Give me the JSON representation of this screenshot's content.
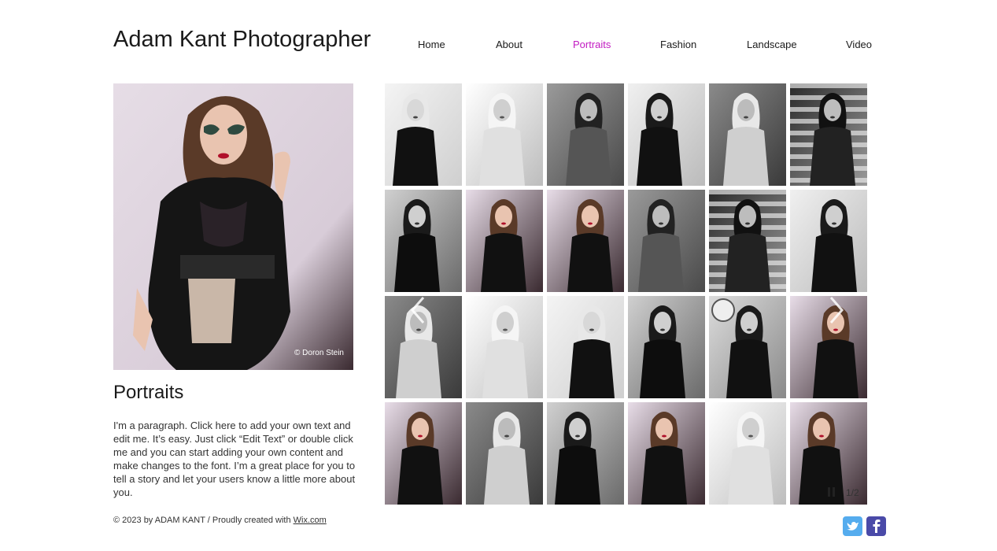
{
  "site": {
    "title": "Adam Kant Photographer"
  },
  "nav": {
    "items": [
      {
        "label": "Home",
        "active": false
      },
      {
        "label": "About",
        "active": false
      },
      {
        "label": "Portraits",
        "active": true
      },
      {
        "label": "Fashion",
        "active": false
      },
      {
        "label": "Landscape",
        "active": false
      },
      {
        "label": "Video",
        "active": false
      }
    ],
    "active_color": "#c21bc2"
  },
  "feature": {
    "credit": "© Doron Stein"
  },
  "section": {
    "title": "Portraits",
    "paragraph": "I'm a paragraph. Click here to add your own text and edit me. It’s easy. Just click “Edit Text” or double click me and you can start adding your own content and make changes to the font. I’m a great place for you to tell a story and let your users know a little more about you."
  },
  "gallery": {
    "counter": "1/2",
    "thumbnails": [
      "wind-hair",
      "white-feathers",
      "arms-crossed",
      "raised-arm-dress",
      "feather-hair",
      "striped-shadow",
      "dark-jacket",
      "red-lips-color",
      "red-lips-color",
      "arms-crossed",
      "striped-shadow",
      "raised-arm-dress",
      "feather-hair",
      "white-feathers",
      "wind-hair",
      "dark-jacket",
      "clock-pose",
      "red-lips-color",
      "red-lips-color",
      "feather-hair",
      "dark-jacket",
      "red-lips-color",
      "white-feathers",
      "red-lips-color"
    ]
  },
  "footer": {
    "text": "© 2023 by ADAM KANT / Proudly created with ",
    "link": "Wix.com"
  },
  "social": [
    {
      "name": "twitter-icon",
      "color": "#55acee"
    },
    {
      "name": "facebook-icon",
      "color": "#4a4aa8"
    }
  ]
}
